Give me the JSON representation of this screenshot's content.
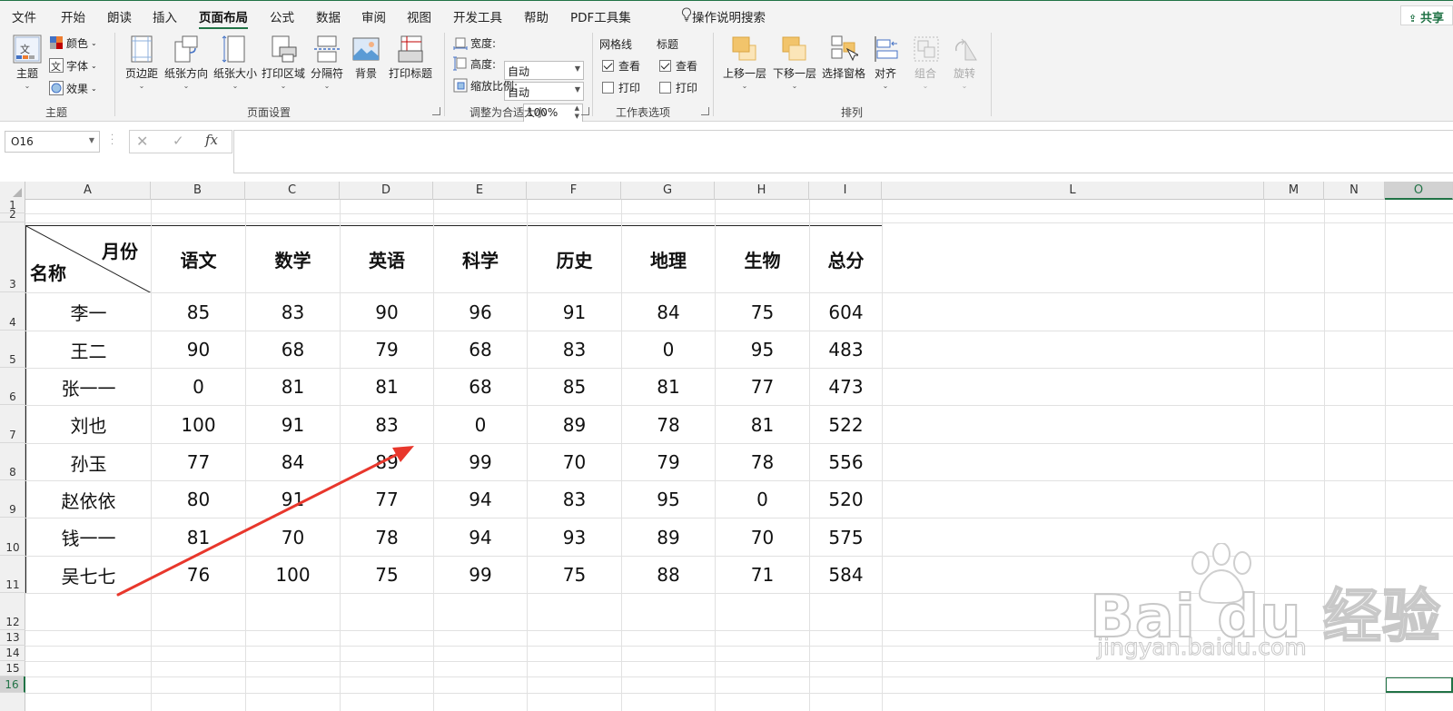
{
  "menu": {
    "items": [
      "文件",
      "开始",
      "朗读",
      "插入",
      "页面布局",
      "公式",
      "数据",
      "审阅",
      "视图",
      "开发工具",
      "帮助",
      "PDF工具集"
    ],
    "active": "页面布局",
    "search": "操作说明搜索",
    "share": "共享"
  },
  "ribbon": {
    "theme_group": {
      "label": "主题",
      "theme_btn": "主题",
      "colors": "颜色",
      "fonts": "字体",
      "effects": "效果"
    },
    "page_setup": {
      "label": "页面设置",
      "margins": "页边距",
      "orientation": "纸张方向",
      "size": "纸张大小",
      "print_area": "打印区域",
      "breaks": "分隔符",
      "background": "背景",
      "print_titles": "打印标题"
    },
    "scale": {
      "label": "调整为合适大小",
      "width_label": "宽度:",
      "width_value": "自动",
      "height_label": "高度:",
      "height_value": "自动",
      "scale_label": "缩放比例:",
      "scale_value": "100%"
    },
    "sheet_options": {
      "label": "工作表选项",
      "gridlines": "网格线",
      "headings": "标题",
      "view": "查看",
      "print": "打印"
    },
    "arrange": {
      "label": "排列",
      "bring_forward": "上移一层",
      "send_backward": "下移一层",
      "selection_pane": "选择窗格",
      "align": "对齐",
      "group": "组合",
      "rotate": "旋转"
    }
  },
  "formula_bar": {
    "name_box": "O16",
    "fx": "fx",
    "value": ""
  },
  "sheet": {
    "columns": [
      "A",
      "B",
      "C",
      "D",
      "E",
      "F",
      "G",
      "H",
      "I",
      "L",
      "M",
      "N",
      "O"
    ],
    "selected_column": "O",
    "rows": [
      "1",
      "2",
      "3",
      "4",
      "5",
      "6",
      "7",
      "8",
      "9",
      "10",
      "11",
      "12",
      "13",
      "14",
      "15",
      "16"
    ],
    "selected_row": "16",
    "table": {
      "diag_top": "月份",
      "diag_bottom": "名称",
      "headers": [
        "语文",
        "数学",
        "英语",
        "科学",
        "历史",
        "地理",
        "生物",
        "总分"
      ],
      "rows": [
        {
          "name": "李一",
          "values": [
            "85",
            "83",
            "90",
            "96",
            "91",
            "84",
            "75",
            "604"
          ]
        },
        {
          "name": "王二",
          "values": [
            "90",
            "68",
            "79",
            "68",
            "83",
            "0",
            "95",
            "483"
          ]
        },
        {
          "name": "张一一",
          "values": [
            "0",
            "81",
            "81",
            "68",
            "85",
            "81",
            "77",
            "473"
          ]
        },
        {
          "name": "刘也",
          "values": [
            "100",
            "91",
            "83",
            "0",
            "89",
            "78",
            "81",
            "522"
          ]
        },
        {
          "name": "孙玉",
          "values": [
            "77",
            "84",
            "89",
            "99",
            "70",
            "79",
            "78",
            "556"
          ]
        },
        {
          "name": "赵依依",
          "values": [
            "80",
            "91",
            "77",
            "94",
            "83",
            "95",
            "0",
            "520"
          ]
        },
        {
          "name": "钱一一",
          "values": [
            "81",
            "70",
            "78",
            "94",
            "93",
            "89",
            "70",
            "575"
          ]
        },
        {
          "name": "吴七七",
          "values": [
            "76",
            "100",
            "75",
            "99",
            "75",
            "88",
            "71",
            "584"
          ]
        }
      ]
    }
  },
  "annotation": {
    "color": "#e8372c"
  },
  "watermark": {
    "brand": "Bai du 经验",
    "url": "jingyan.baidu.com"
  },
  "colors": {
    "accent": "#217346"
  }
}
